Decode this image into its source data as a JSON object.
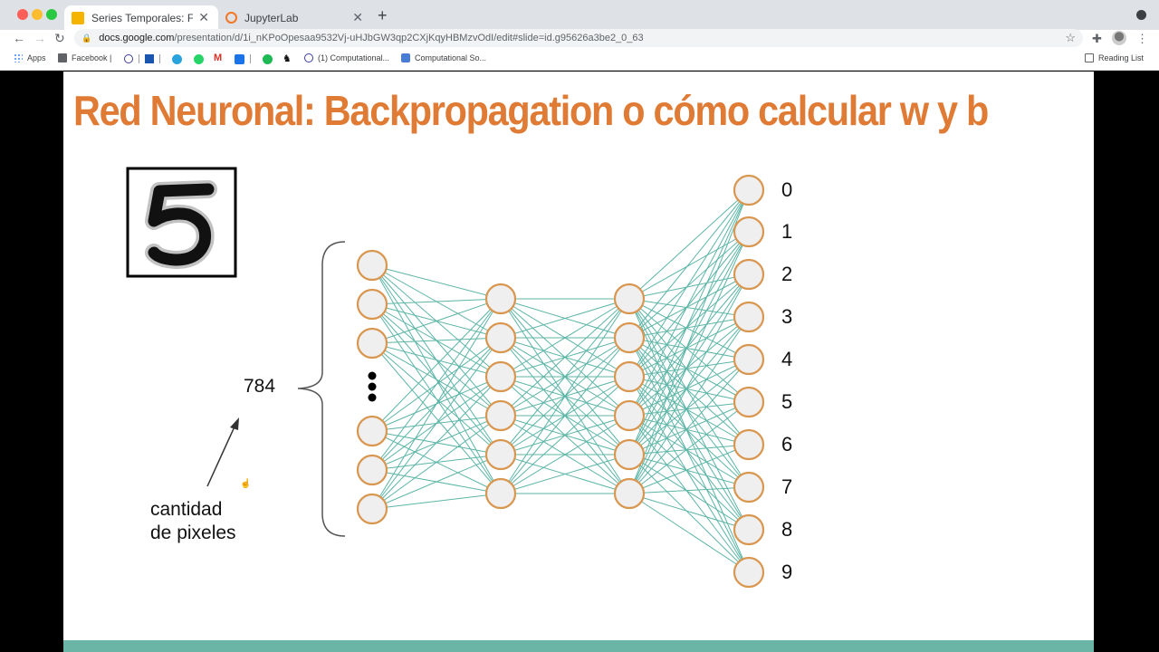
{
  "browser": {
    "tabs": [
      {
        "title": "Series Temporales: Forecasting",
        "active": true
      },
      {
        "title": "JupyterLab",
        "active": false
      }
    ],
    "address": {
      "host": "docs.google.com",
      "path": "/presentation/d/1i_nKPoOpesaa9532Vj-uHJbGW3qp2CXjKqyHBMzvOdI/edit#slide=id.g95626a3be2_0_63"
    },
    "bookmarks": [
      {
        "label": "Apps"
      },
      {
        "label": "Facebook |"
      },
      {
        "label": "(1) Computational..."
      },
      {
        "label": "Computational So..."
      }
    ],
    "reading_list": "Reading List"
  },
  "slide": {
    "title": "Red Neuronal: Backpropagation o cómo calcular w y b",
    "input_count": "784",
    "annotation": [
      "cantidad",
      "de pixeles"
    ],
    "output_labels": [
      "0",
      "1",
      "2",
      "3",
      "4",
      "5",
      "6",
      "7",
      "8",
      "9"
    ],
    "colors": {
      "title": "#e07b35",
      "neuron_stroke": "#d9964f",
      "neuron_fill": "#efefef",
      "edge": "#5cb5a6",
      "footer_bar": "#6ab5a5"
    },
    "layers": {
      "input_shown": 6,
      "hidden1": 6,
      "hidden2": 6,
      "output": 10
    }
  }
}
